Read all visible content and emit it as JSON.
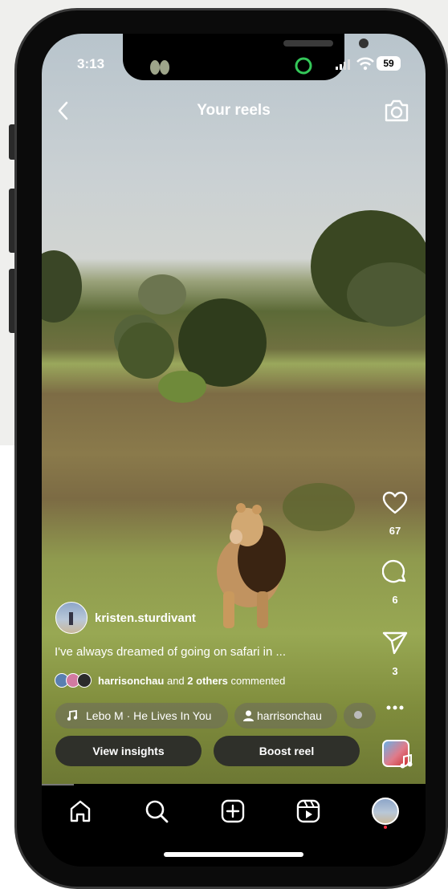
{
  "status_bar": {
    "time": "3:13",
    "battery": "59"
  },
  "header": {
    "title": "Your reels"
  },
  "rail": {
    "likes": "67",
    "comments": "6",
    "shares": "3"
  },
  "post": {
    "username": "kristen.sturdivant",
    "caption": "I've always dreamed of going on safari in ...",
    "commenters_lead": "harrisonchau",
    "commenters_mid": " and ",
    "commenters_others": "2 others",
    "commenters_tail": " commented"
  },
  "chips": {
    "audio": "Lebo M · He Lives In You",
    "tagged_user": "harrisonchau"
  },
  "buttons": {
    "view_insights": "View insights",
    "boost_reel": "Boost reel"
  },
  "icons": [
    "back-arrow-icon",
    "camera-icon",
    "heart-icon",
    "comment-icon",
    "share-icon",
    "more-icon",
    "music-icon",
    "person-icon",
    "home-icon",
    "search-icon",
    "create-icon",
    "reels-icon"
  ]
}
